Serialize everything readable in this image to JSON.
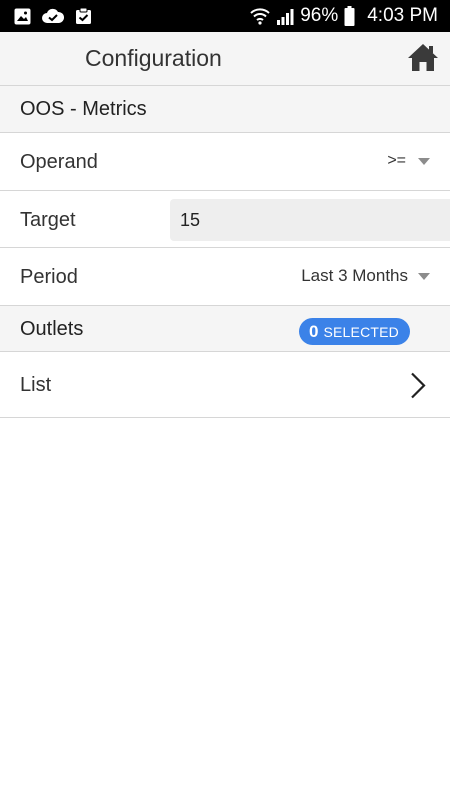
{
  "status_bar": {
    "battery_percent": "96%",
    "time": "4:03 PM",
    "left_icons": [
      "image-icon",
      "cloud-check-icon",
      "clipboard-check-icon"
    ],
    "right_icons": [
      "wifi-icon",
      "signal-icon",
      "battery-icon"
    ]
  },
  "header": {
    "title": "Configuration",
    "home_icon": "home-icon"
  },
  "section": {
    "title": "OOS - Metrics"
  },
  "operand": {
    "label": "Operand",
    "value": ">="
  },
  "target": {
    "label": "Target",
    "value": "15"
  },
  "period": {
    "label": "Period",
    "value": "Last 3 Months"
  },
  "outlets": {
    "label": "Outlets",
    "selected_count": "0",
    "selected_text": "SELECTED",
    "badge_color": "#3b82e8"
  },
  "list": {
    "label": "List",
    "icon": "chevron-right-icon"
  }
}
